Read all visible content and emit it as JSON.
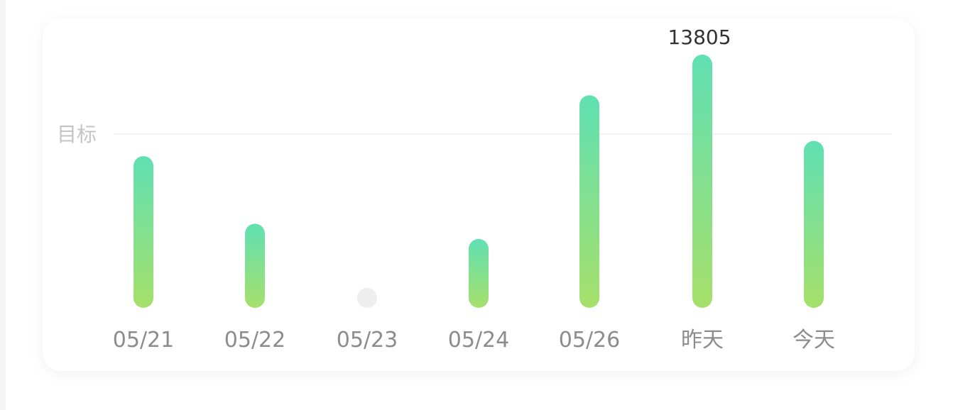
{
  "chart_data": {
    "type": "bar",
    "categories": [
      "05/21",
      "05/22",
      "05/23",
      "05/24",
      "05/26",
      "昨天",
      "今天"
    ],
    "values": [
      7800,
      3800,
      0,
      2900,
      11400,
      13805,
      8700
    ],
    "annotations": [
      {
        "index": 5,
        "text": "13805"
      }
    ],
    "target_label": "目标",
    "target_value": 9700,
    "ylim": [
      0,
      13805
    ],
    "grid": false,
    "legend": "none",
    "colors": {
      "bar_top": "#60e0b3",
      "bar_bottom": "#a6e06a",
      "empty_dot": "#eeeeee",
      "target_line": "#f2f2f2",
      "target_text": "#c4c4c4",
      "tick_text": "#8c8c8c",
      "value_text": "#333333"
    }
  }
}
